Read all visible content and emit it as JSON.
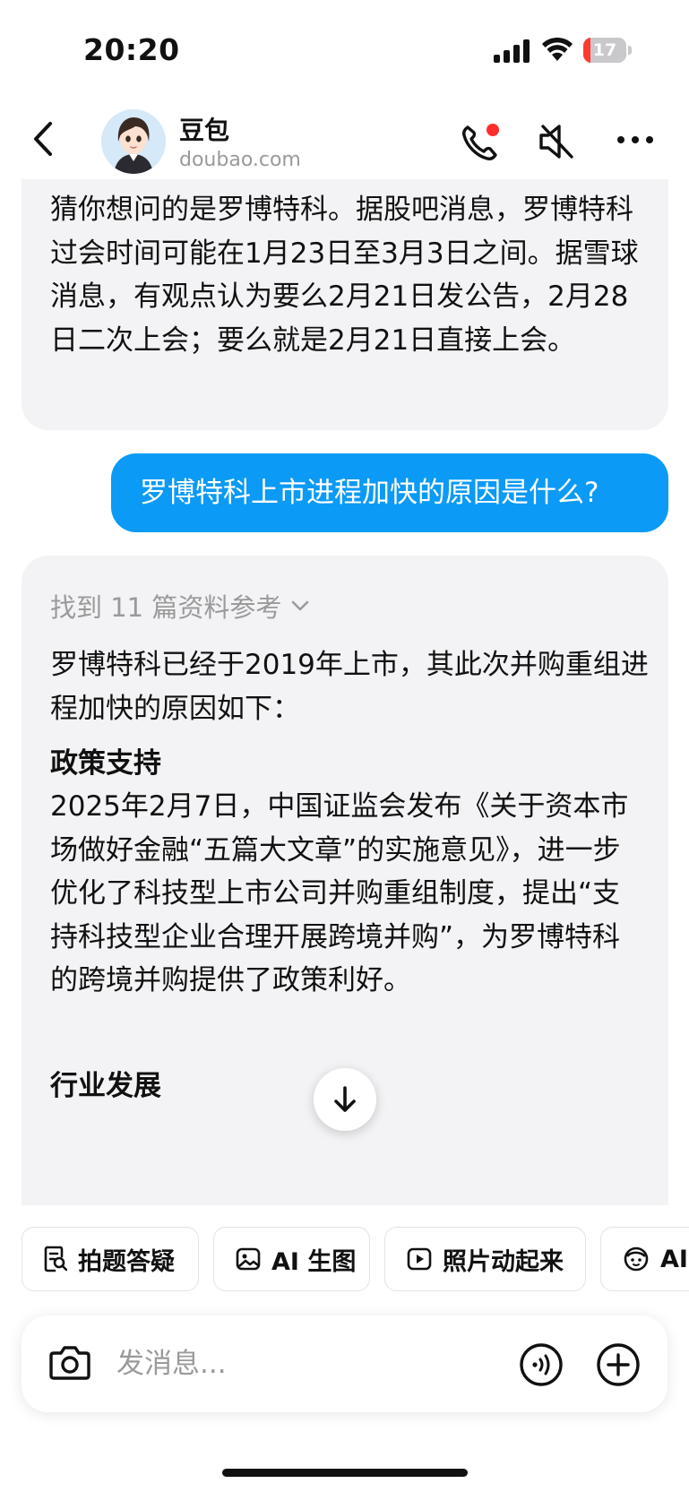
{
  "status_bar": {
    "time": "20:20",
    "battery_level": "17",
    "battery_color": "#ff3b30"
  },
  "header": {
    "name": "豆包",
    "domain": "doubao.com",
    "call_indicator_color": "#ff2d2d"
  },
  "messages": {
    "bot_previous": "猜你想问的是罗博特科。据股吧消息，罗博特科过会时间可能在1月23日至3月3日之间。据雪球消息，有观点认为要么2月21日发公告，2月28日二次上会；要么就是2月21日直接上会。",
    "user": "罗博特科上市进程加快的原因是什么?",
    "bot_answer": {
      "references": "找到 11 篇资料参考",
      "intro": "罗博特科已经于2019年上市，其此次并购重组进程加快的原因如下：",
      "heading_policy": "政策支持",
      "policy_text": "2025年2月7日，中国证监会发布《关于资本市场做好金融“五篇大文章”的实施意见》，进一步优化了科技型上市公司并购重组制度，提出“支持科技型企业合理开展跨境并购”，为罗博特科的跨境并购提供了政策利好。",
      "heading_industry": "行业发展"
    }
  },
  "quick_actions": [
    {
      "label": "拍题答疑",
      "icon": "photo-question-icon"
    },
    {
      "label": "AI 生图",
      "icon": "image-icon"
    },
    {
      "label": "照片动起来",
      "icon": "play-icon"
    },
    {
      "label": "AI",
      "icon": "face-icon"
    }
  ],
  "input": {
    "placeholder": "发消息..."
  },
  "colors": {
    "user_bubble": "#0b9af5",
    "bot_bubble": "#f3f3f5"
  }
}
